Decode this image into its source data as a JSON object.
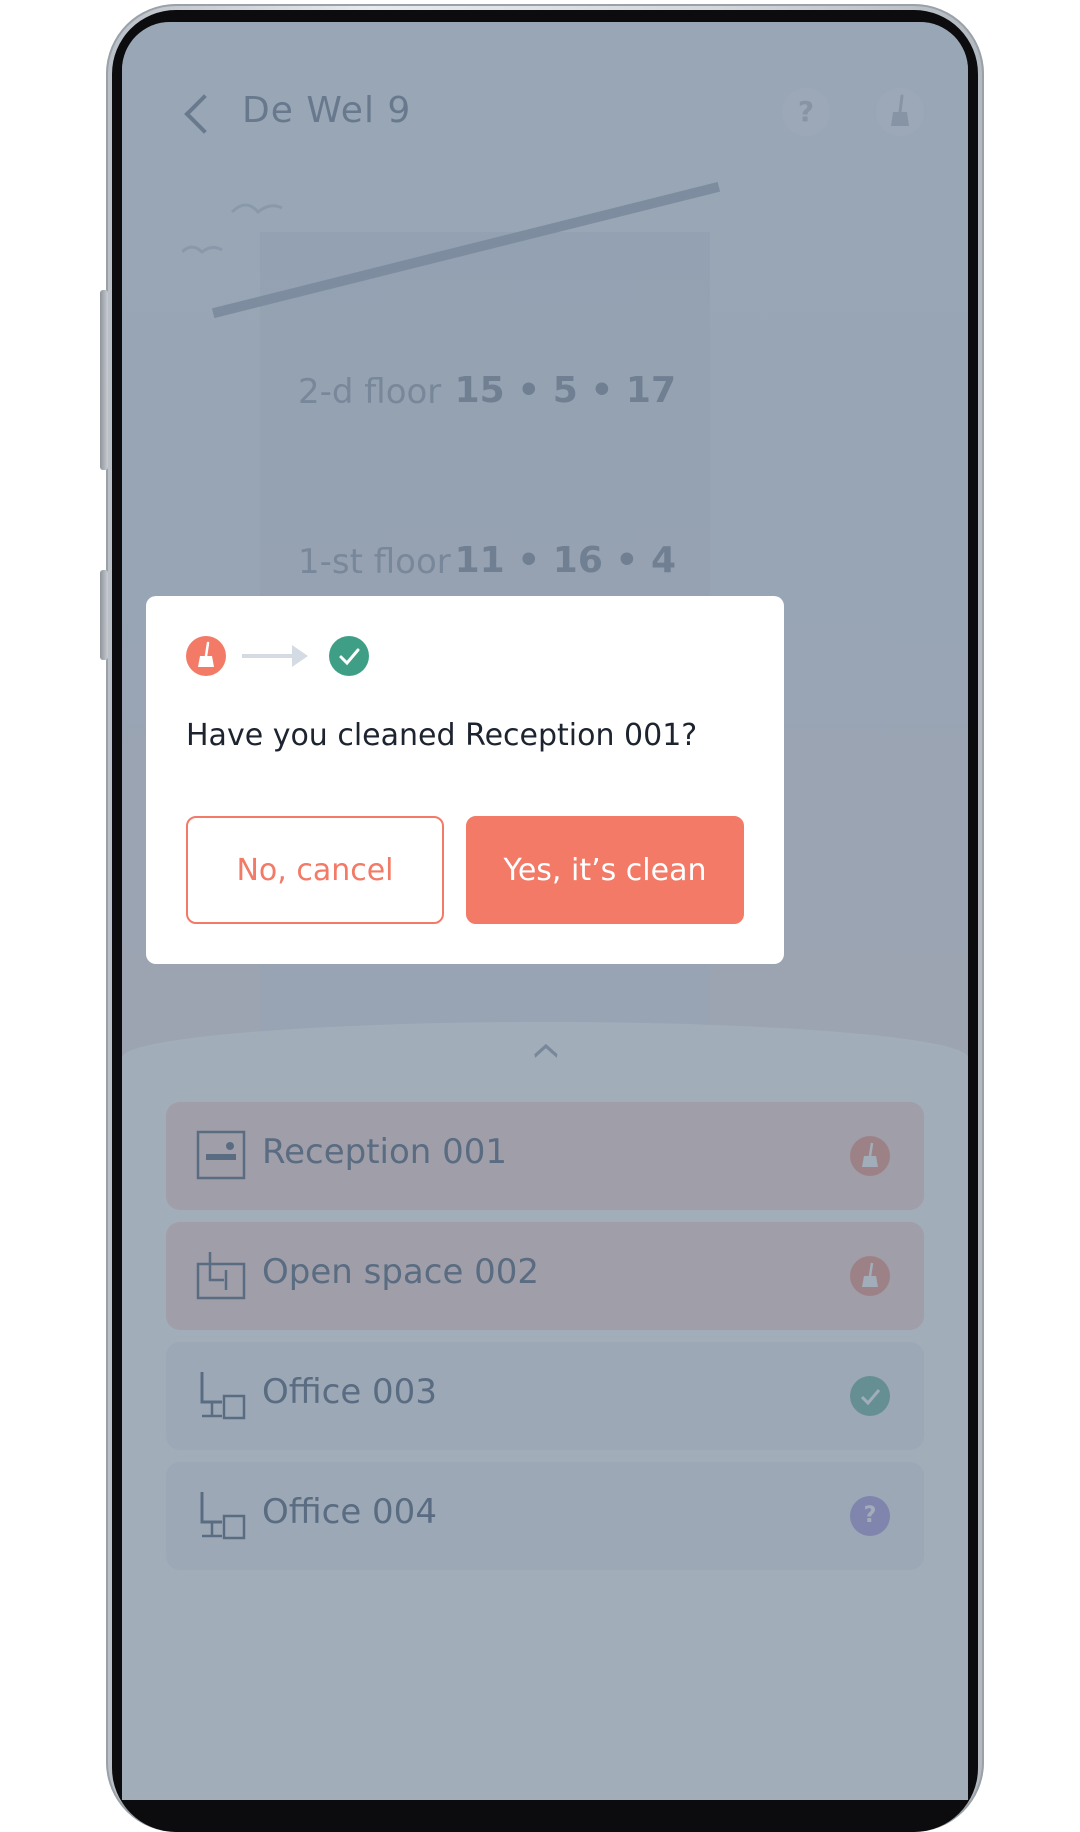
{
  "app_bar": {
    "title": "De Wel 9",
    "back_icon": "chevron-left-icon",
    "help_icon": "help-icon",
    "help_glyph": "?",
    "cleaning_icon": "broom-icon"
  },
  "floors": [
    {
      "label": "2-d floor",
      "stats": "15 • 5 • 17"
    },
    {
      "label": "1-st floor",
      "stats": "11 • 16 • 4"
    }
  ],
  "rooms": [
    {
      "name": "Reception 001",
      "icon": "reception-desk-icon",
      "status": "dirty"
    },
    {
      "name": "Open space 002",
      "icon": "open-space-desk-icon",
      "status": "dirty"
    },
    {
      "name": "Office 003",
      "icon": "office-chair-desk-icon",
      "status": "clean"
    },
    {
      "name": "Office 004",
      "icon": "office-chair-desk-icon",
      "status": "unknown",
      "status_glyph": "?"
    }
  ],
  "dialog": {
    "question": "Have you cleaned Reception 001?",
    "cancel_label": "No, cancel",
    "confirm_label": "Yes, it’s clean",
    "from_icon": "broom-icon",
    "to_icon": "check-icon"
  },
  "colors": {
    "accent": "#f27a66",
    "clean": "#3f9f86",
    "unknown": "#b9aee4",
    "overlay": "#465c76"
  }
}
